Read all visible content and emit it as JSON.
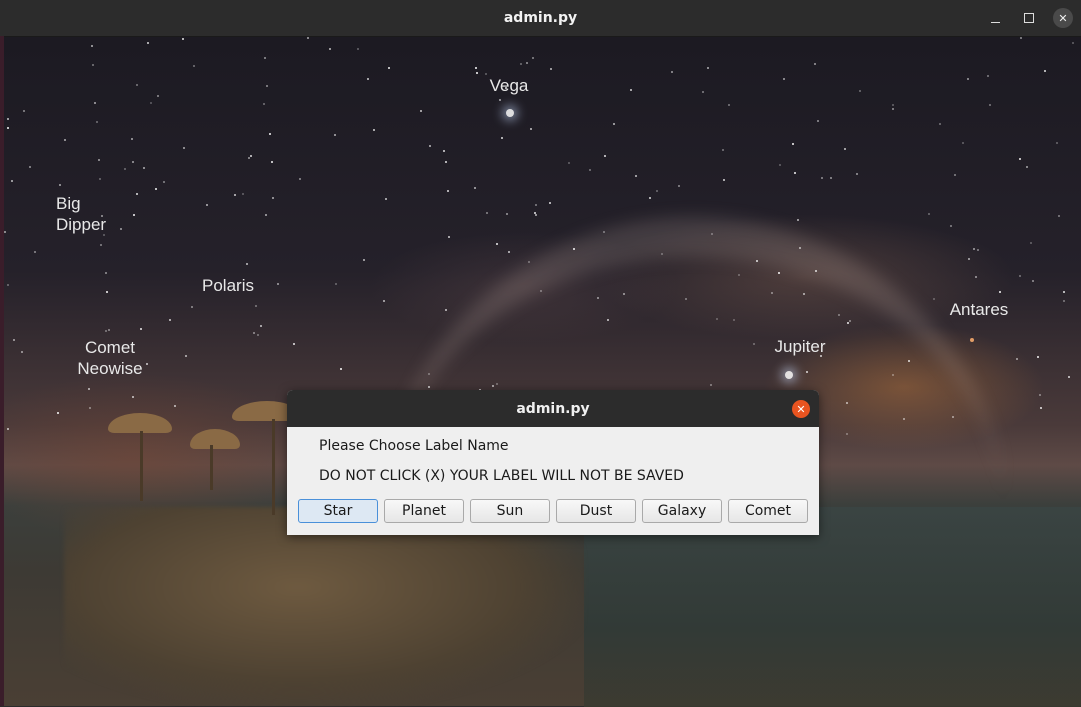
{
  "window": {
    "title": "admin.py"
  },
  "sky_labels": {
    "vega": "Vega",
    "big_dipper": "Big\nDipper",
    "polaris": "Polaris",
    "comet_neowise": "Comet\nNeowise",
    "jupiter": "Jupiter",
    "antares": "Antares"
  },
  "dialog": {
    "title": "admin.py",
    "prompt": "Please Choose Label Name",
    "warning": "DO NOT CLICK (X) YOUR LABEL WILL NOT BE SAVED",
    "buttons": [
      "Star",
      "Planet",
      "Sun",
      "Dust",
      "Galaxy",
      "Comet"
    ]
  },
  "icons": {
    "window_minimize": "minimize-icon",
    "window_maximize": "maximize-icon",
    "window_close": "close-icon",
    "dialog_close": "close-icon"
  },
  "colors": {
    "titlebar": "#2c2c2c",
    "dialog_bg": "#efefef",
    "close_accent": "#e95420",
    "focus_border": "#4a90d9"
  }
}
